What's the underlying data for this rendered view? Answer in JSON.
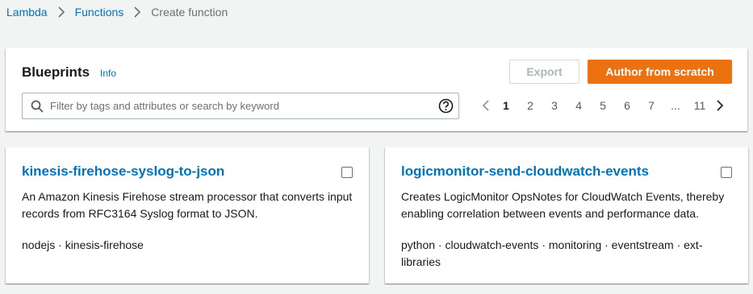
{
  "breadcrumb": {
    "items": [
      {
        "label": "Lambda"
      },
      {
        "label": "Functions"
      },
      {
        "label": "Create function"
      }
    ]
  },
  "blueprints": {
    "title": "Blueprints",
    "info_label": "Info",
    "export_label": "Export",
    "author_label": "Author from scratch",
    "search": {
      "placeholder": "Filter by tags and attributes or search by keyword",
      "value": ""
    },
    "pagination": {
      "pages": [
        "1",
        "2",
        "3",
        "4",
        "5",
        "6",
        "7",
        "...",
        "11"
      ],
      "current": "1"
    }
  },
  "cards": [
    {
      "title": "kinesis-firehose-syslog-to-json",
      "description": "An Amazon Kinesis Firehose stream processor that converts input records from RFC3164 Syslog format to JSON.",
      "tags": "nodejs · kinesis-firehose"
    },
    {
      "title": "logicmonitor-send-cloudwatch-events",
      "description": "Creates LogicMonitor OpsNotes for CloudWatch Events, thereby enabling correlation between events and performance data.",
      "tags": "python · cloudwatch-events · monitoring · eventstream · ext-libraries"
    }
  ],
  "colors": {
    "link": "#0073bb",
    "primary_button": "#ec7211",
    "background": "#f2f3f3"
  },
  "icons": [
    "chevron-right-icon",
    "search-icon",
    "help-icon",
    "chevron-left-icon",
    "checkbox"
  ]
}
